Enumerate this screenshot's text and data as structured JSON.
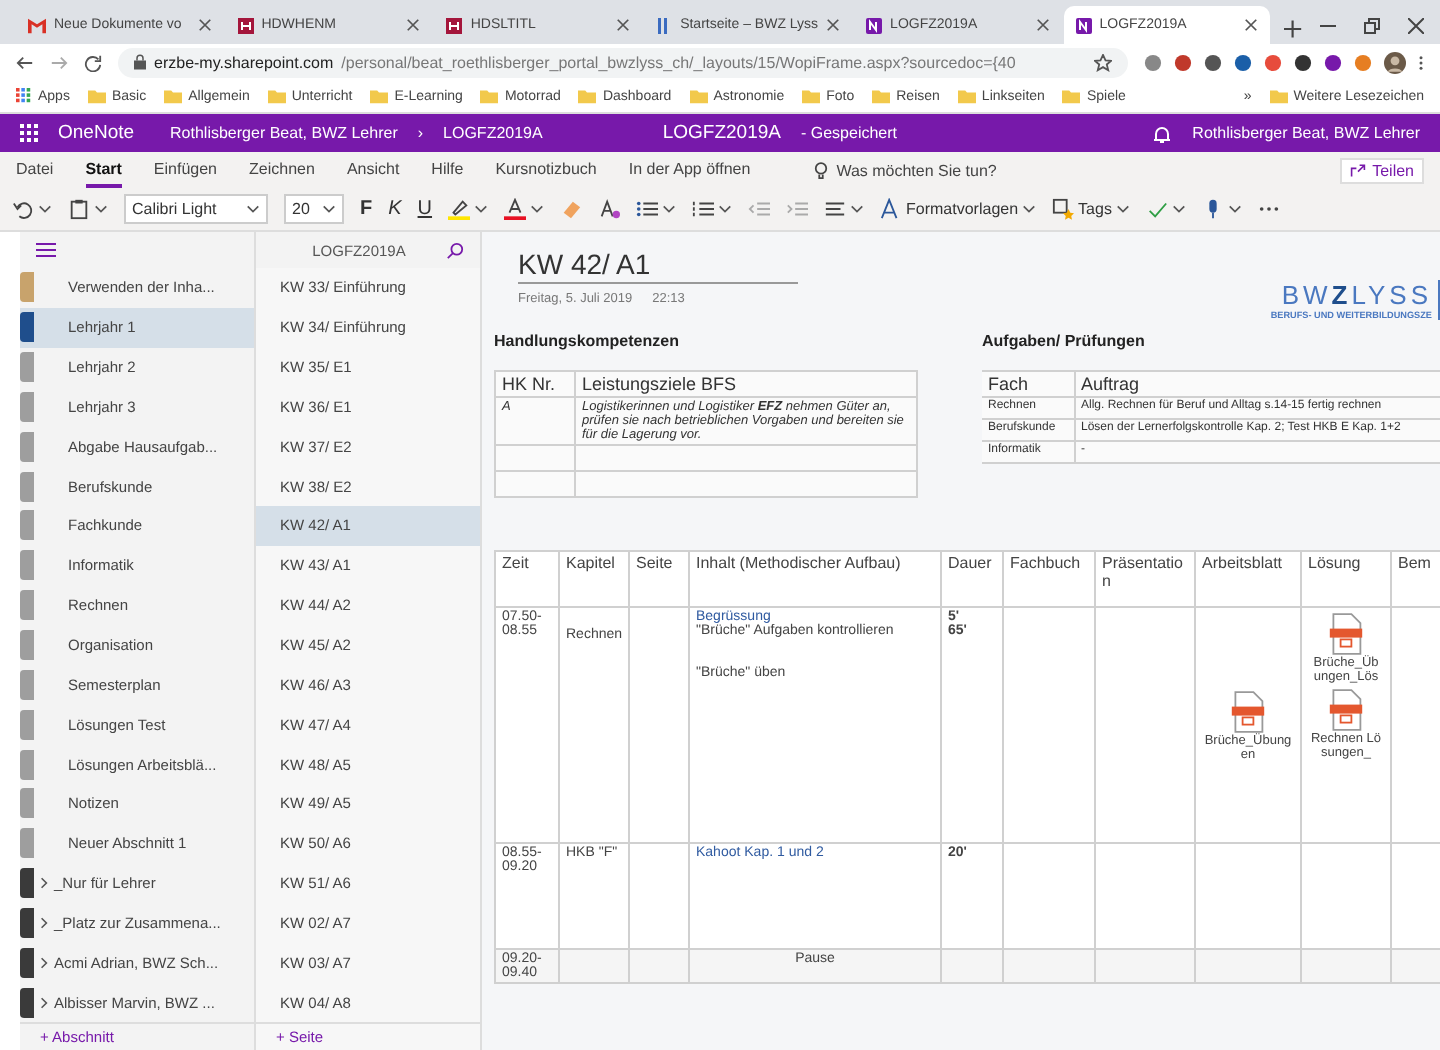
{
  "browser": {
    "tabs": [
      {
        "kind": "gmail",
        "title": "Neue Dokumente vo",
        "selected": false
      },
      {
        "kind": "h",
        "title": "HDWHENM",
        "selected": false
      },
      {
        "kind": "h",
        "title": "HDSLTITL",
        "selected": false
      },
      {
        "kind": "bars",
        "title": "Startseite – BWZ Lyss",
        "selected": false
      },
      {
        "kind": "onenote",
        "title": "LOGFZ2019A",
        "selected": false
      },
      {
        "kind": "onenote",
        "title": "LOGFZ2019A",
        "selected": true
      }
    ],
    "url_host": "erzbe-my.sharepoint.com",
    "url_path": "/personal/beat_roethlisberger_portal_bwzlyss_ch/_layouts/15/WopiFrame.aspx?sourcedoc={40",
    "bookmarks": [
      "Basic",
      "Allgemein",
      "Unterricht",
      "E-Learning",
      "Motorrad",
      "Dashboard",
      "Astronomie",
      "Foto",
      "Reisen",
      "Linkseiten",
      "Spiele"
    ],
    "apps_label": "Apps",
    "more_bookmarks": "»",
    "other_bookmarks": "Weitere Lesezeichen"
  },
  "app_bar": {
    "app": "OneNote",
    "breadcrumb_owner": "Rothlisberger Beat, BWZ Lehrer",
    "breadcrumb_separator": "›",
    "breadcrumb_notebook": "LOGFZ2019A",
    "doc_title": "LOGFZ2019A",
    "doc_status": "-   Gespeichert",
    "user": "Rothlisberger Beat, BWZ Lehrer"
  },
  "ribbon": {
    "menu": [
      {
        "label": "Datei",
        "selected": false
      },
      {
        "label": "Start",
        "selected": true
      },
      {
        "label": "Einfügen",
        "selected": false
      },
      {
        "label": "Zeichnen",
        "selected": false
      },
      {
        "label": "Ansicht",
        "selected": false
      },
      {
        "label": "Hilfe",
        "selected": false
      },
      {
        "label": "Kursnotizbuch",
        "selected": false
      },
      {
        "label": "In der App öffnen",
        "selected": false
      }
    ],
    "search": "Was möchten Sie tun?",
    "share": "Teilen",
    "tools": [
      {
        "kind": "undo"
      },
      {
        "kind": "paste"
      },
      {
        "kind": "font",
        "text": "Calibri Light"
      },
      {
        "kind": "size",
        "text": "20"
      },
      {
        "kind": "bold",
        "text": "F"
      },
      {
        "kind": "italic",
        "text": "K"
      },
      {
        "kind": "underline",
        "text": "U"
      },
      {
        "kind": "highlight"
      },
      {
        "kind": "fontcolor"
      },
      {
        "kind": "eraser"
      },
      {
        "kind": "clearstyle"
      },
      {
        "kind": "bullets"
      },
      {
        "kind": "numbering"
      },
      {
        "kind": "outdent"
      },
      {
        "kind": "indent"
      },
      {
        "kind": "align"
      },
      {
        "kind": "styles",
        "text": "Formatvorlagen"
      },
      {
        "kind": "tags",
        "text": "Tags"
      },
      {
        "kind": "spelling"
      },
      {
        "kind": "dictate"
      },
      {
        "kind": "more"
      }
    ]
  },
  "sidebar": {
    "notebook": "LOGFZ2019A",
    "sections": [
      {
        "kind": "section",
        "label": "Verwenden der Inha...",
        "color": "#c8a36c",
        "selected": false
      },
      {
        "kind": "section",
        "label": "Lehrjahr 1",
        "color": "#1f4e8c",
        "selected": true
      },
      {
        "kind": "section",
        "label": "Lehrjahr 2",
        "color": "#9e9e9e",
        "selected": false
      },
      {
        "kind": "section",
        "label": "Lehrjahr 3",
        "color": "#9e9e9e",
        "selected": false
      },
      {
        "kind": "section",
        "label": "Abgabe Hausaufgab...",
        "color": "#9e9e9e",
        "selected": false
      },
      {
        "kind": "section",
        "label": "Berufskunde",
        "color": "#9e9e9e",
        "selected": false
      },
      {
        "kind": "section",
        "label": "Fachkunde",
        "color": "#9e9e9e",
        "selected": false
      },
      {
        "kind": "section",
        "label": "Informatik",
        "color": "#9e9e9e",
        "selected": false
      },
      {
        "kind": "section",
        "label": "Rechnen",
        "color": "#9e9e9e",
        "selected": false
      },
      {
        "kind": "section",
        "label": "Organisation",
        "color": "#9e9e9e",
        "selected": false
      },
      {
        "kind": "section",
        "label": "Semesterplan",
        "color": "#9e9e9e",
        "selected": false
      },
      {
        "kind": "section",
        "label": "Lösungen Test",
        "color": "#9e9e9e",
        "selected": false
      },
      {
        "kind": "section",
        "label": "Lösungen Arbeitsblä...",
        "color": "#9e9e9e",
        "selected": false
      },
      {
        "kind": "section",
        "label": "Notizen",
        "color": "#9e9e9e",
        "selected": false
      },
      {
        "kind": "section",
        "label": "Neuer Abschnitt 1",
        "color": "#9e9e9e",
        "selected": false
      },
      {
        "kind": "group",
        "label": "_Nur für Lehrer",
        "color": "#3a3a3a",
        "selected": false
      },
      {
        "kind": "group",
        "label": "_Platz zur Zusammena...",
        "color": "#3a3a3a",
        "selected": false
      },
      {
        "kind": "group",
        "label": "Acmi Adrian, BWZ Sch...",
        "color": "#3a3a3a",
        "selected": false
      },
      {
        "kind": "group",
        "label": "Albisser Marvin, BWZ ...",
        "color": "#3a3a3a",
        "selected": false
      }
    ],
    "pages": [
      {
        "label": "KW 33/ Einführung",
        "selected": false
      },
      {
        "label": "KW 34/ Einführung",
        "selected": false
      },
      {
        "label": "KW 35/ E1",
        "selected": false
      },
      {
        "label": "KW 36/ E1",
        "selected": false
      },
      {
        "label": "KW 37/ E2",
        "selected": false
      },
      {
        "label": "KW 38/ E2",
        "selected": false
      },
      {
        "label": "KW 42/ A1",
        "selected": true
      },
      {
        "label": "KW 43/ A1",
        "selected": false
      },
      {
        "label": "KW 44/ A2",
        "selected": false
      },
      {
        "label": "KW 45/ A2",
        "selected": false
      },
      {
        "label": "KW 46/ A3",
        "selected": false
      },
      {
        "label": "KW 47/ A4",
        "selected": false
      },
      {
        "label": "KW 48/ A5",
        "selected": false
      },
      {
        "label": "KW 49/ A5",
        "selected": false
      },
      {
        "label": "KW 50/ A6",
        "selected": false
      },
      {
        "label": "KW 51/ A6",
        "selected": false
      },
      {
        "label": "KW 02/ A7",
        "selected": false
      },
      {
        "label": "KW 03/ A7",
        "selected": false
      },
      {
        "label": "KW 04/ A8",
        "selected": false
      }
    ],
    "add_section": "+ Abschnitt",
    "add_page": "+ Seite"
  },
  "page": {
    "title": "KW 42/ A1",
    "date": "Freitag, 5. Juli 2019",
    "time": "22:13",
    "logo": {
      "bw": "BW",
      "z": "Z",
      "lyss": "LYSS",
      "tagline": "BERUFS- UND WEITERBILDUNGSZE"
    },
    "competences": {
      "heading": "Handlungskompetenzen",
      "columns": [
        "HK Nr.",
        "Leistungsziele BFS"
      ],
      "rows": [
        [
          "A",
          "Logistikerinnen und Logistiker **EFZ** nehmen Güter an, prüfen sie nach betrieblichen Vorgaben und bereiten sie für die Lagerung vor."
        ]
      ]
    },
    "tasks": {
      "heading": "Aufgaben/ Prüfungen",
      "columns": [
        "Fach",
        "Auftrag"
      ],
      "rows": [
        [
          "Rechnen",
          "Allg. Rechnen für Beruf und Alltag s.14-15 fertig rechnen"
        ],
        [
          "Berufskunde",
          "Lösen der Lernerfolgskontrolle Kap. 2; Test HKB E Kap. 1+2"
        ],
        [
          "Informatik",
          "-"
        ]
      ]
    },
    "schedule": {
      "columns": [
        "Zeit",
        "Kapitel",
        "Seite",
        "Inhalt (Methodischer Aufbau)",
        "Dauer",
        "Fachbuch",
        "Präsentation",
        "Arbeitsblatt",
        "Lösung",
        "Bem"
      ],
      "rows": [
        {
          "kind": "lesson",
          "time": "07.50-08.55",
          "chapter": "Rechnen",
          "content": [
            [
              {
                "kind": "link",
                "text": "Begrüssung"
              },
              {
                "kind": "text",
                "text": "\"Brüche\" Aufgaben kontrollieren"
              }
            ],
            [
              {
                "kind": "text",
                "text": "\"Brüche\" üben"
              }
            ]
          ],
          "duration": [
            "5'",
            "65'"
          ],
          "worksheets": [
            "Brüche_Übungen"
          ],
          "solutions": [
            "Brüche_Übungen_Lös",
            "Rechnen Lösungen_"
          ]
        },
        {
          "kind": "lesson",
          "time": "08.55-09.20",
          "chapter": "HKB \"F\"",
          "content": [
            [
              {
                "kind": "link",
                "text": "Kahoot Kap. 1 und 2"
              }
            ]
          ],
          "duration": [
            "20'"
          ]
        },
        {
          "kind": "break",
          "time": "09.20-09.40",
          "label": "Pause"
        }
      ]
    }
  }
}
